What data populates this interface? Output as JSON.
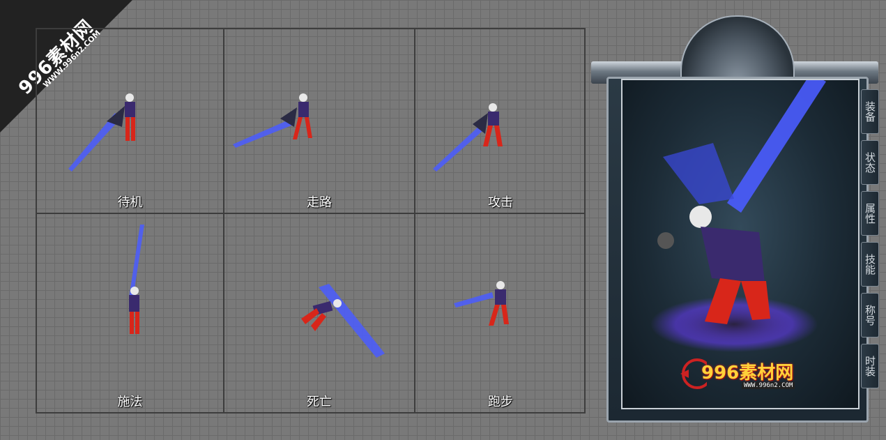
{
  "watermark": {
    "brand": "996素材网",
    "url": "WWW.996n2.COM"
  },
  "frames": [
    {
      "label": "待机"
    },
    {
      "label": "走路"
    },
    {
      "label": "攻击"
    },
    {
      "label": "施法"
    },
    {
      "label": "死亡"
    },
    {
      "label": "跑步"
    }
  ],
  "panel": {
    "tabs": [
      {
        "label": "装备"
      },
      {
        "label": "状态"
      },
      {
        "label": "属性"
      },
      {
        "label": "技能"
      },
      {
        "label": "称号"
      },
      {
        "label": "时装"
      }
    ],
    "logo_text": "996素材网",
    "logo_url": "WWW.996n2.COM"
  },
  "colors": {
    "background": "#797979",
    "sword_glow": "#4a5cff",
    "pants": "#d8261a",
    "vest": "#3a2a6e"
  }
}
